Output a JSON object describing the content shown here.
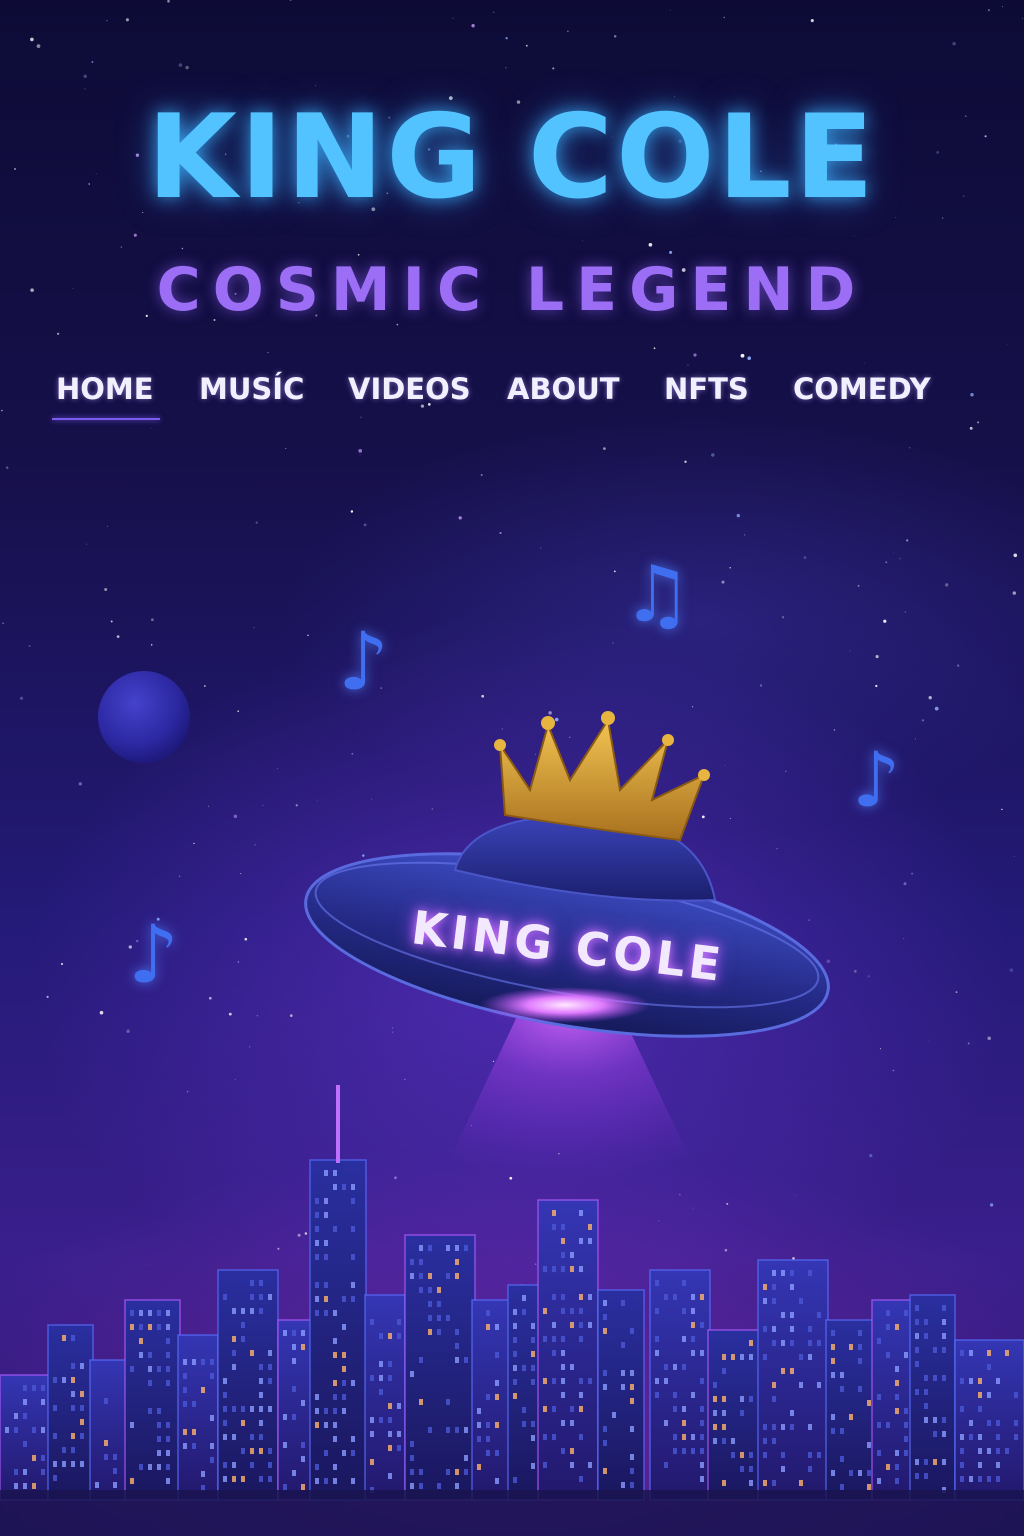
{
  "header": {
    "title": "KING COLE",
    "subtitle": "COSMIC LEGEND"
  },
  "nav": {
    "items": [
      {
        "label": "HOME",
        "active": true
      },
      {
        "label": "MUSÍC",
        "active": false
      },
      {
        "label": "VIDEOS",
        "active": false
      },
      {
        "label": "ABOUT",
        "active": false
      },
      {
        "label": "NFTS",
        "active": false
      },
      {
        "label": "COMEDY",
        "active": false
      }
    ]
  },
  "hero": {
    "ufo_label": "KING COLE",
    "note_glyph": "♪"
  },
  "colors": {
    "title": "#52c3ff",
    "subtitle": "#9b6ef5",
    "nav_text": "#f2f0ff",
    "active_underline": "#7a5cf0",
    "ufo_glow": "#c66bff",
    "crown": "#d9a434",
    "notes": "#3f6ff0"
  },
  "icons": [
    "music-note-icon",
    "crown-icon",
    "ufo-icon",
    "planet-icon",
    "city-skyline"
  ]
}
